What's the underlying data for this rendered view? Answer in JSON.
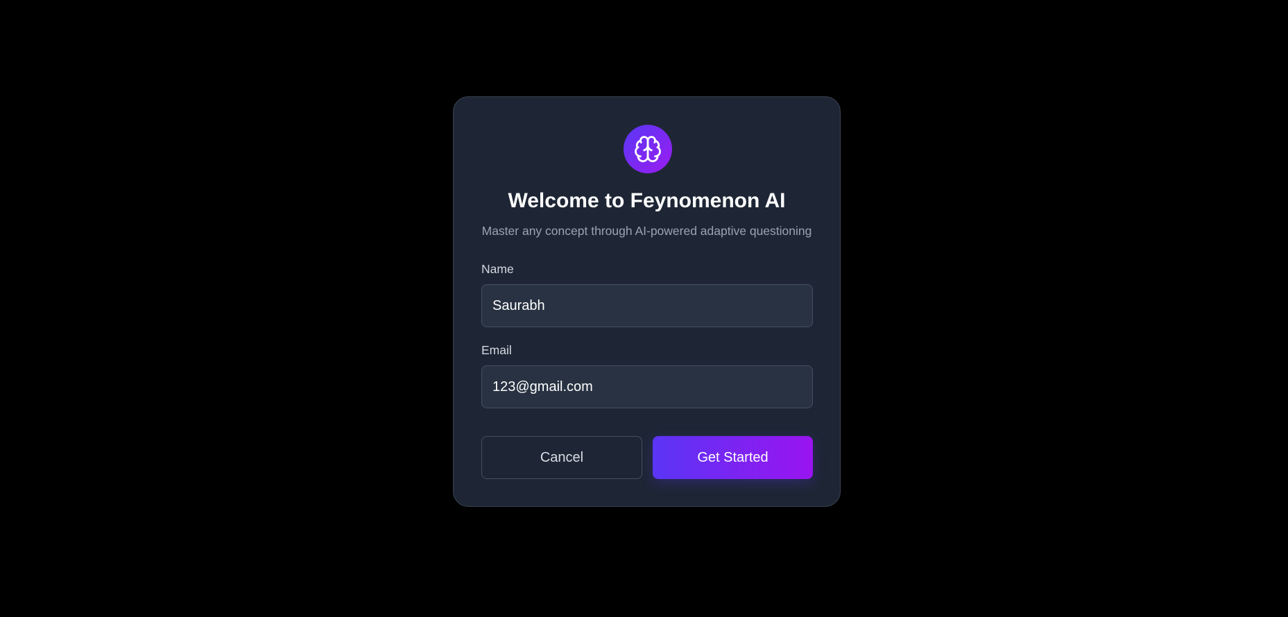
{
  "app": {
    "title": "Welcome to Feynomenon AI",
    "subtitle": "Master any concept through AI-powered adaptive questioning",
    "logo_icon": "brain-icon"
  },
  "form": {
    "name_label": "Name",
    "name_value": "Saurabh",
    "email_label": "Email",
    "email_value": "123@gmail.com"
  },
  "actions": {
    "cancel_label": "Cancel",
    "submit_label": "Get Started"
  },
  "colors": {
    "background": "#000000",
    "card": "#1e2635",
    "input_bg": "#283242",
    "accent_start": "#5a35f5",
    "accent_end": "#9a14f0"
  }
}
